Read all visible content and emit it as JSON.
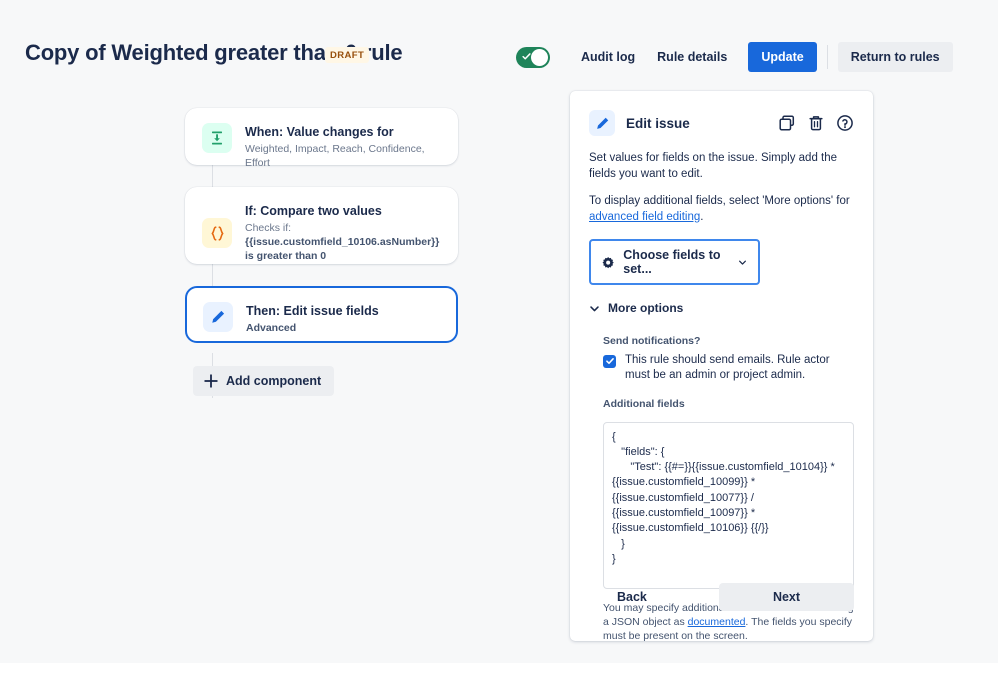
{
  "header": {
    "title": "Copy of Weighted greater than 0 rule",
    "status_badge": "DRAFT",
    "toggle_enabled": true,
    "audit_log": "Audit log",
    "rule_details": "Rule details",
    "update": "Update",
    "return_to_rules": "Return to rules",
    "accent_color": "#1868db",
    "toggle_color": "#1f845a",
    "badge_bg": "#fff7e6",
    "badge_color": "#974f0c"
  },
  "flow": {
    "add_component": "Add component",
    "cards": [
      {
        "title": "When: Value changes for",
        "subtitle": "Weighted, Impact, Reach, Confidence, Effort",
        "icon": "value-change-icon",
        "selected": false
      },
      {
        "title": "If: Compare two values",
        "subtitle": "Checks if:",
        "code": "{{issue.customfield_10106.asNumber}} is greater than 0",
        "icon": "curly-braces-icon",
        "selected": false
      },
      {
        "title": "Then: Edit issue fields",
        "subtitle": "Advanced",
        "icon": "pencil-icon",
        "selected": true
      }
    ]
  },
  "panel": {
    "title": "Edit issue",
    "icon": "pencil-icon",
    "tools": [
      {
        "name": "duplicate-icon"
      },
      {
        "name": "trash-icon"
      },
      {
        "name": "help-icon"
      }
    ],
    "description_1": "Set values for fields on the issue. Simply add the fields you want to edit.",
    "description_2_prefix": "To display additional fields, select 'More options' for ",
    "description_2_link": "advanced field editing",
    "description_2_suffix": ".",
    "choose_fields_label": "Choose fields to set...",
    "more_options_label": "More options",
    "send_notifications_label": "Send notifications?",
    "send_notifications_checked": true,
    "send_notifications_text": "This rule should send emails. Rule actor must be an admin or project admin.",
    "additional_fields_label": "Additional fields",
    "additional_fields_value": "{\n   \"fields\": {\n      \"Test\": {{#=}}{{issue.customfield_10104}} * {{issue.customfield_10099}} * {{issue.customfield_10077}} / {{issue.customfield_10097}} * {{issue.customfield_10106}} {{/}}\n   }\n}",
    "help_prefix": "You may specify additional field values to be set using a JSON object as ",
    "help_link": "documented",
    "help_suffix": ". The fields you specify must be present on the screen.",
    "back_label": "Back",
    "next_label": "Next"
  }
}
